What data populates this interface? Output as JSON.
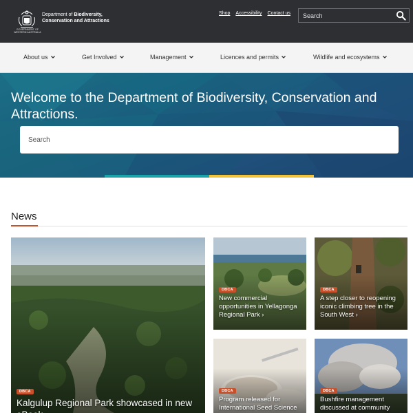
{
  "header": {
    "crest_caption": "GOVERNMENT OF WESTERN AUSTRALIA",
    "dept_line1_prefix": "Department of ",
    "dept_line1_bold": "Biodiversity,",
    "dept_line2": "Conservation and Attractions",
    "links": [
      "Shop",
      "Accessibility",
      "Contact us"
    ],
    "search_placeholder": "Search"
  },
  "nav": {
    "items": [
      "About us",
      "Get Involved",
      "Management",
      "Licences and permits",
      "Wildlife and ecosystems"
    ]
  },
  "hero": {
    "title": "Welcome to the Department of Biodiversity, Conservation and Attractions.",
    "search_placeholder": "Search"
  },
  "news": {
    "heading": "News",
    "featured": {
      "badge": "DBCA",
      "title": "Kalgulup Regional Park showcased in new ",
      "title_tail": "eBook"
    },
    "cards": [
      {
        "badge": "DBCA",
        "title": "New commercial opportunities in Yellagonga Regional Park ›"
      },
      {
        "badge": "DBCA",
        "title": "A step closer to reopening iconic climbing tree in the South West ›"
      },
      {
        "badge": "DBCA",
        "title": "Program released for International Seed Science"
      },
      {
        "badge": "DBCA",
        "title": "Bushfire management discussed at community"
      }
    ]
  },
  "colors": {
    "header_bg": "#2d2f33",
    "accent": "#c8502a",
    "stripe_teal": "#1aa3a9",
    "stripe_yellow": "#f2c23b"
  }
}
